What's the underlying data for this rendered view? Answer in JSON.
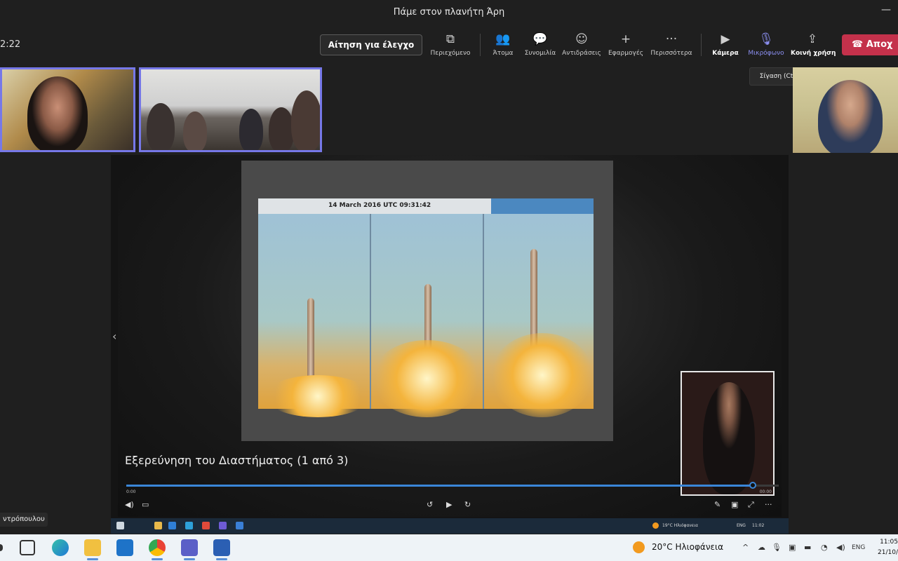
{
  "window": {
    "title": "Πάμε στον πλανήτη Άρη",
    "minimize": "—"
  },
  "toolbar": {
    "timer": "2:22",
    "request_control": "Αίτηση για έλεγχο",
    "tools": [
      {
        "label": "Περιεχόμενο",
        "icon": "share-tray-icon",
        "glyph": "⧉"
      },
      {
        "label": "Άτομα",
        "icon": "people-icon",
        "glyph": "👥"
      },
      {
        "label": "Συνομιλία",
        "icon": "chat-icon",
        "glyph": "💬"
      },
      {
        "label": "Αντιδράσεις",
        "icon": "reactions-icon",
        "glyph": "☺"
      },
      {
        "label": "Εφαρμογές",
        "icon": "apps-icon",
        "glyph": "+"
      },
      {
        "label": "Περισσότερα",
        "icon": "more-icon",
        "glyph": "···"
      },
      {
        "label": "Κάμερα",
        "icon": "camera-icon",
        "glyph": "▶"
      },
      {
        "label": "Μικρόφωνο",
        "icon": "microphone-icon",
        "glyph": "🎙"
      },
      {
        "label": "Κοινή χρήση",
        "icon": "share-screen-icon",
        "glyph": "⇪"
      }
    ],
    "leave": "Αποχ",
    "leave_icon": "☎",
    "tooltip": "Σίγαση (Ctrl+Shift+M)"
  },
  "presentation": {
    "slide_caption": "14 March 2016     UTC 09:31:42",
    "subtitle": "Εξερεύνηση του Διαστήματος (1 από 3)",
    "progress": 0.96,
    "time_left": "0:00",
    "time_right": "00:00",
    "inner_weather": "19°C  Ηλιόφανεια",
    "inner_lang": "ENG",
    "inner_clock": "11:02"
  },
  "participant_name": "ντρόπουλου",
  "taskbar": {
    "weather": "20°C  Ηλιοφάνεια",
    "lang": "ENG",
    "time": "11:05",
    "date": "21/10/"
  },
  "colors": {
    "accent": "#7678e8",
    "leave": "#c4314b",
    "progress": "#3a86d8"
  }
}
